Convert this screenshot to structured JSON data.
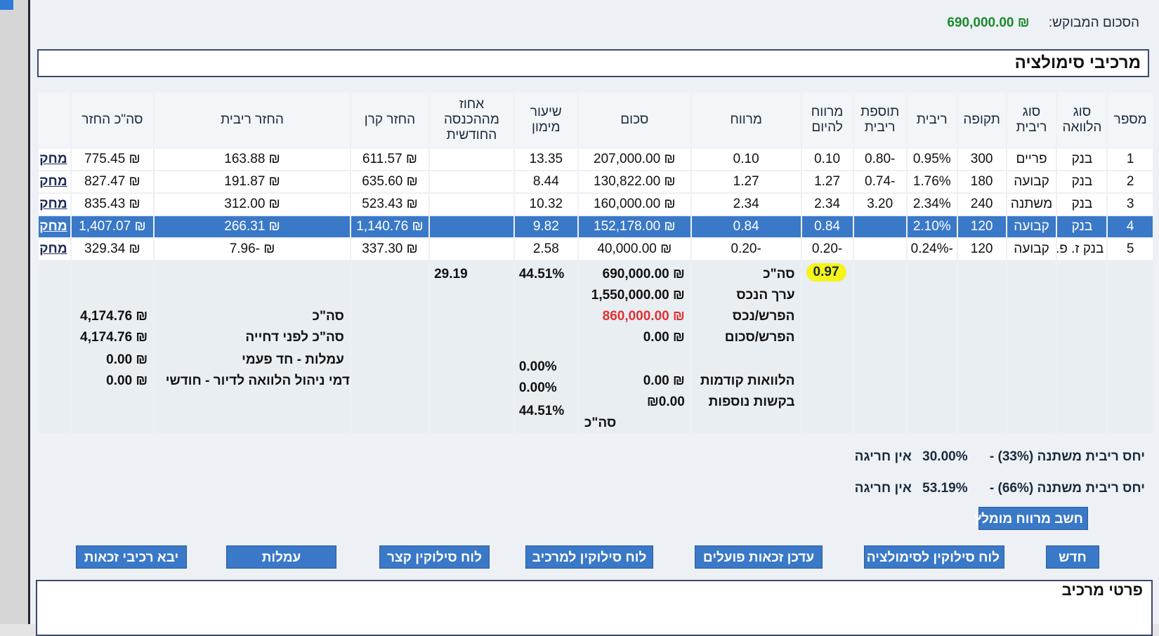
{
  "requested": {
    "label": "הסכום המבוקש:",
    "amount": "₪ 690,000.00"
  },
  "section_title": "מרכיבי סימולציה",
  "columns": [
    "מספר",
    "סוג הלוואה",
    "סוג ריבית",
    "תקופה",
    "ריבית",
    "תוספת ריבית",
    "מרווח להיום",
    "מרווח",
    "סכום",
    "שיעור מימון",
    "אחוז מההכנסה החודשית",
    "החזר קרן",
    "החזר ריבית",
    "סה\"כ החזר",
    ""
  ],
  "rows": [
    [
      "1",
      "בנק",
      "פריים",
      "300",
      "0.95%",
      "-0.80",
      "0.10",
      "0.10",
      "₪ 207,000.00",
      "13.35",
      "",
      "₪ 611.57",
      "₪ 163.88",
      "₪ 775.45",
      "מחק"
    ],
    [
      "2",
      "בנק",
      "קבועה",
      "180",
      "1.76%",
      "-0.74",
      "1.27",
      "1.27",
      "₪ 130,822.00",
      "8.44",
      "",
      "₪ 635.60",
      "₪ 191.87",
      "₪ 827.47",
      "מחק"
    ],
    [
      "3",
      "בנק",
      "משתנה",
      "240",
      "2.34%",
      "3.20",
      "2.34",
      "2.34",
      "₪ 160,000.00",
      "10.32",
      "",
      "₪ 523.43",
      "₪ 312.00",
      "₪ 835.43",
      "מחק"
    ],
    [
      "4",
      "בנק",
      "קבועה",
      "120",
      "2.10%",
      "",
      "0.84",
      "0.84",
      "₪ 152,178.00",
      "9.82",
      "",
      "₪ 1,140.76",
      "₪ 266.31",
      "₪ 1,407.07",
      "מחק"
    ],
    [
      "5",
      "בנק ז. פ.",
      "קבועה",
      "120",
      "-0.24%",
      "",
      "-0.20",
      "-0.20",
      "₪ 40,000.00",
      "2.58",
      "",
      "₪ 337.30",
      "₪ -7.96",
      "₪ 329.34",
      "מחק"
    ]
  ],
  "summary": {
    "margin_today_total": "0.97",
    "labels": {
      "total": "סה\"כ",
      "property_value": "ערך הנכס",
      "diff_property": "הפרש/נכס",
      "diff_amount": "הפרש/סכום",
      "previous_loans": "הלוואות קודמות",
      "additional_requests": "בקשות נוספות",
      "total2": "סה\"כ"
    },
    "amounts": {
      "total": "₪ 690,000.00",
      "property_value": "₪ 1,550,000.00",
      "diff_property": "₪ 860,000.00",
      "diff_amount": "₪ 0.00",
      "previous_loans": "₪  0.00",
      "additional_requests": "₪0.00"
    },
    "financing": {
      "total": "44.51%",
      "previous_loans": "0.00%",
      "additional_requests": "0.00%",
      "total2": "44.51%"
    },
    "income_percent": "29.19",
    "totals": {
      "total_label": "סה\"כ",
      "total_value": "₪ 4,174.76",
      "before_deferral_label": "סה\"כ לפני דחייה",
      "before_deferral_value": "₪ 4,174.76",
      "fees_once_label": "עמלות - חד פעמי",
      "fees_once_value": "₪ 0.00",
      "mgmt_fees_label": "דמי ניהול הלוואה לדיור - חודשי",
      "mgmt_fees_value": "₪ 0.00"
    }
  },
  "ratios": [
    {
      "label": "יחס ריבית משתנה (33%) -",
      "value": "30.00%",
      "status": "אין חריגה"
    },
    {
      "label": "יחס ריבית משתנה (66%) -",
      "value": "53.19%",
      "status": "אין חריגה"
    }
  ],
  "buttons": {
    "calc_margin": "חשב מרווח מומלץ",
    "new": "חדש",
    "sim_schedule": "לוח סילוקין לסימולציה",
    "update_rights": "עדכן זכאות פועלים",
    "component_schedule": "לוח סילוקין למרכיב",
    "short_schedule": "לוח סילוקין קצר",
    "fees": "עמלות",
    "import_rights": "יבא רכיבי זכאות"
  },
  "bottom_panel_title": "פרטי מרכיב",
  "colors": {
    "accent": "#3a78c8",
    "green": "#1a8a2a",
    "red": "#e03030",
    "highlight": "#f5f51a"
  }
}
